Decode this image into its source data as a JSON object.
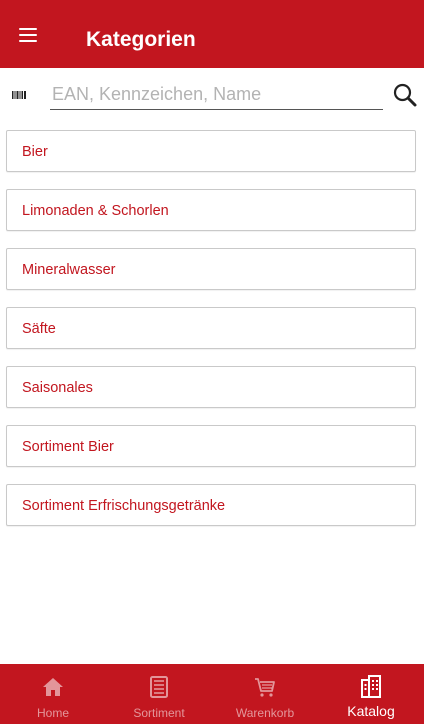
{
  "appbar": {
    "title": "Kategorien"
  },
  "search": {
    "placeholder": "EAN, Kennzeichen, Name",
    "value": ""
  },
  "categories": [
    {
      "label": "Bier"
    },
    {
      "label": "Limonaden & Schorlen"
    },
    {
      "label": "Mineralwasser"
    },
    {
      "label": "Säfte"
    },
    {
      "label": "Saisonales"
    },
    {
      "label": "Sortiment Bier"
    },
    {
      "label": "Sortiment Erfrischungsgetränke"
    }
  ],
  "bottom_nav": [
    {
      "label": "Home",
      "icon": "home-icon",
      "active": false
    },
    {
      "label": "Sortiment",
      "icon": "list-icon",
      "active": false
    },
    {
      "label": "Warenkorb",
      "icon": "cart-icon",
      "active": false
    },
    {
      "label": "Katalog",
      "icon": "catalog-icon",
      "active": true
    }
  ],
  "colors": {
    "brand": "#c2161f",
    "text_accent": "#c2161f",
    "border": "#c9c9c9"
  }
}
